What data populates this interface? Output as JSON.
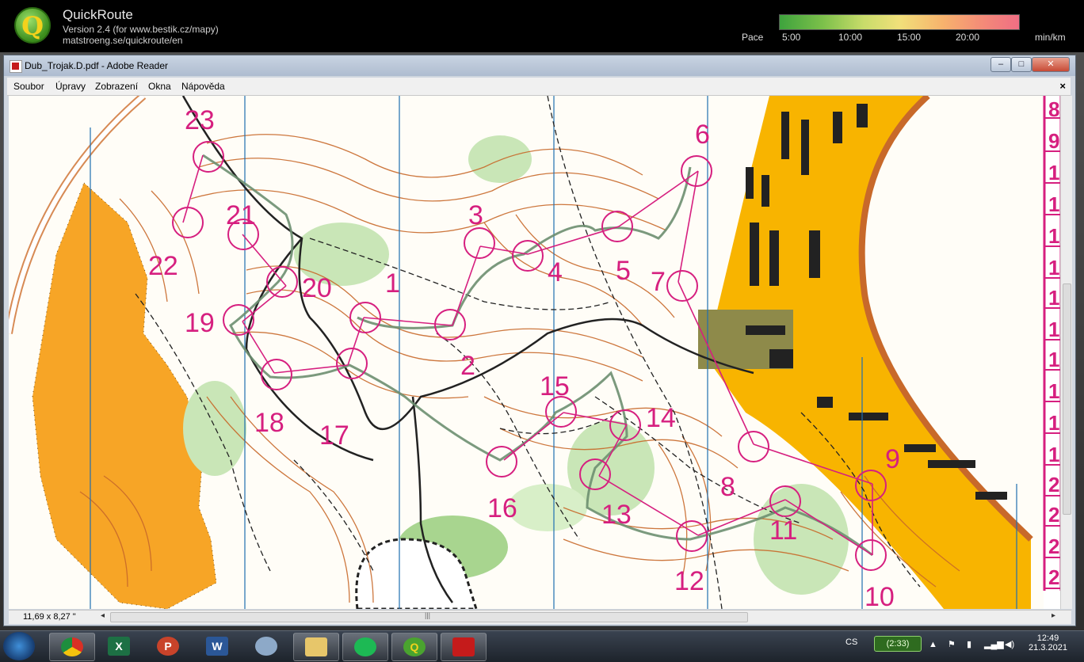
{
  "quickroute": {
    "app_name": "QuickRoute",
    "version": "Version 2.4  (for www.bestik.cz/mapy)",
    "url": "matstroeng.se/quickroute/en",
    "pace_label": "Pace",
    "pace_ticks": [
      "5:00",
      "10:00",
      "15:00",
      "20:00"
    ],
    "pace_unit": "min/km"
  },
  "window": {
    "title": "Dub_Trojak.D.pdf - Adobe Reader",
    "minimize": "–",
    "maximize": "□",
    "close": "✕"
  },
  "menu": {
    "items": [
      "Soubor",
      "Úpravy",
      "Zobrazení",
      "Okna",
      "Nápověda"
    ],
    "close": "×"
  },
  "map": {
    "control_numbers": [
      "1",
      "2",
      "3",
      "4",
      "5",
      "6",
      "7",
      "8",
      "9",
      "10",
      "11",
      "12",
      "13",
      "14",
      "15",
      "16",
      "17",
      "18",
      "19",
      "20",
      "21",
      "22",
      "23"
    ],
    "legend_column": [
      "8",
      "9",
      "1",
      "1",
      "1",
      "1",
      "1",
      "1",
      "1",
      "1",
      "1",
      "1",
      "2",
      "2",
      "2",
      "2"
    ]
  },
  "status": {
    "page_size": "11,69 x 8,27 \"",
    "scroll_grip": "|||"
  },
  "taskbar": {
    "apps": [
      "start-orb",
      "chrome",
      "excel",
      "powerpoint",
      "word",
      "paint",
      "explorer",
      "spotify",
      "quickroute",
      "adobe-reader"
    ],
    "excel_letter": "X",
    "ppt_letter": "P",
    "word_letter": "W",
    "quickroute_letter": "Q",
    "lang": "CS",
    "battery": "(2:33)",
    "time": "12:49",
    "date": "21.3.2021"
  },
  "colors": {
    "course": "#d61f7f",
    "contour": "#c8692a",
    "meridian": "#1f6fb0",
    "sand": "#f7a526",
    "green": "#a8d58f"
  }
}
